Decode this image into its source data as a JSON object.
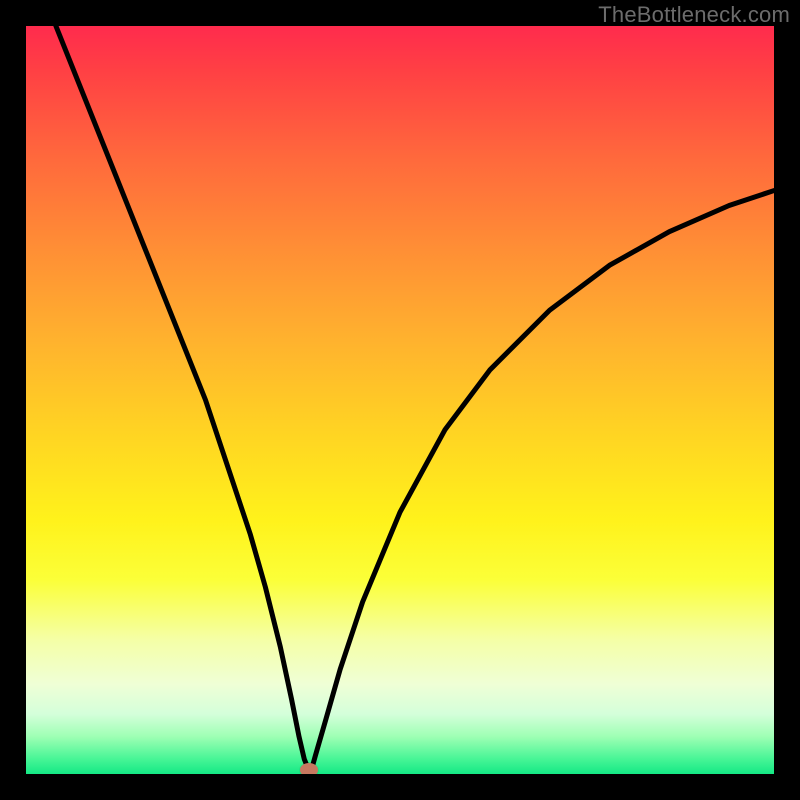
{
  "watermark": "TheBottleneck.com",
  "chart_data": {
    "type": "line",
    "title": "",
    "xlabel": "",
    "ylabel": "",
    "xlim": [
      0,
      100
    ],
    "ylim": [
      0,
      100
    ],
    "grid": false,
    "series": [
      {
        "name": "bottleneck-curve",
        "x": [
          4,
          8,
          12,
          16,
          20,
          24,
          27,
          30,
          32,
          34,
          35.5,
          36.5,
          37.2,
          37.8,
          38.2,
          38.7,
          40,
          42,
          45,
          50,
          56,
          62,
          70,
          78,
          86,
          94,
          100
        ],
        "y": [
          100,
          90,
          80,
          70,
          60,
          50,
          41,
          32,
          25,
          17,
          10,
          5,
          2,
          0.5,
          0.7,
          2.5,
          7,
          14,
          23,
          35,
          46,
          54,
          62,
          68,
          72.5,
          76,
          78
        ]
      }
    ],
    "annotations": [
      {
        "name": "optimum-marker",
        "x": 37.8,
        "y": 0.5
      }
    ],
    "colors": {
      "curve": "#000000",
      "marker": "#c77860",
      "gradient_top": "#ff2b4d",
      "gradient_bottom": "#14e985"
    }
  }
}
